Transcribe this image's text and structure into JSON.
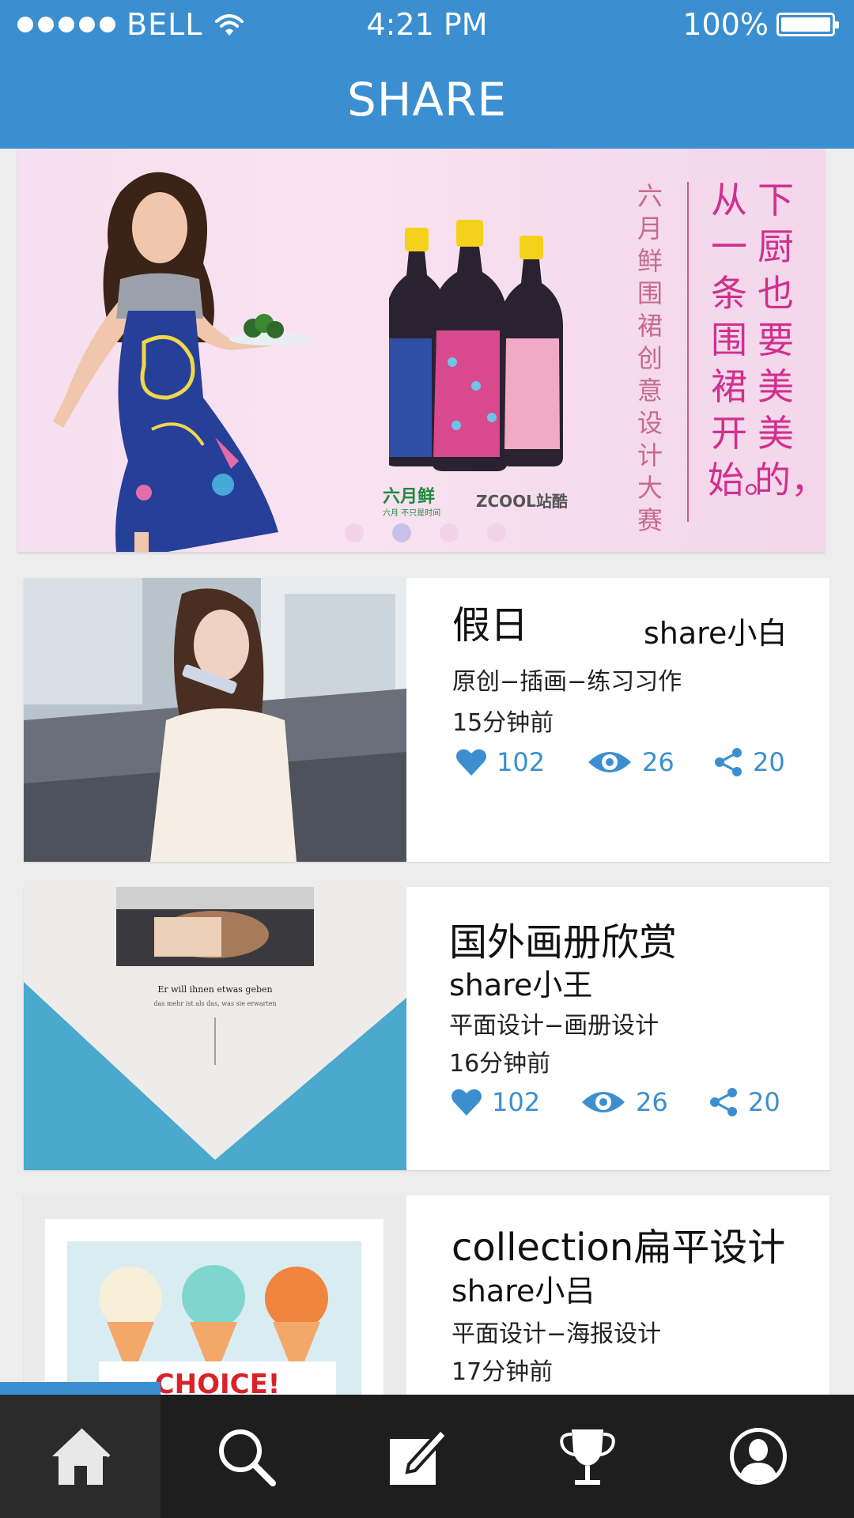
{
  "status_bar": {
    "carrier": "BELL",
    "time": "4:21 PM",
    "battery": "100%"
  },
  "app": {
    "title": "SHARE"
  },
  "banner": {
    "vertical_small": "六月鲜围裙创意设计大赛",
    "vertical_big_col1": "从一条围裙开始。",
    "vertical_big_col2": "下厨也要美美的，",
    "logo_left": "六月鲜",
    "logo_left_sub": "六月 不只是时间",
    "logo_right": "ZCOOL站酷",
    "page_count": 4,
    "active_page": 2
  },
  "cards": [
    {
      "title": "假日",
      "author": "share小白",
      "tag": "原创−插画−练习习作",
      "time": "15分钟前",
      "likes": "102",
      "views": "26",
      "shares": "20"
    },
    {
      "title": "国外画册欣赏",
      "author": "share小王",
      "tag": "平面设计−画册设计",
      "time": "16分钟前",
      "likes": "102",
      "views": "26",
      "shares": "20"
    },
    {
      "title": "collection扁平设计",
      "author": "share小吕",
      "tag": "平面设计−海报设计",
      "time": "17分钟前"
    }
  ],
  "thumb_text": {
    "card2_line1": "Er will ihnen etwas geben",
    "card2_line2": "das mehr ist als das, was sie erwarten",
    "card3_banner": "CHOICE!"
  },
  "tabs": [
    {
      "icon": "home-icon",
      "active": true
    },
    {
      "icon": "search-icon",
      "active": false
    },
    {
      "icon": "edit-icon",
      "active": false
    },
    {
      "icon": "trophy-icon",
      "active": false
    },
    {
      "icon": "profile-icon",
      "active": false
    }
  ],
  "colors": {
    "accent": "#3b8fd0",
    "tabbar": "#1e1e1e",
    "banner_text": "#d0308f"
  }
}
